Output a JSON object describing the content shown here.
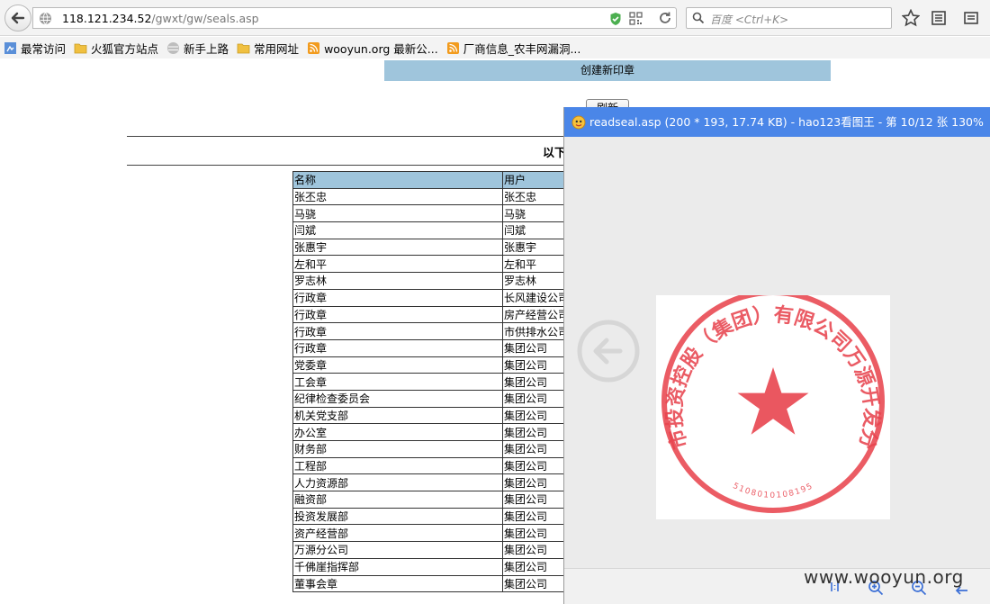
{
  "browser": {
    "url_host": "118.121.234.52",
    "url_path": "/gwxt/gw/seals.asp",
    "search_placeholder": "百度 <Ctrl+K>"
  },
  "bookmarks": [
    {
      "label": "最常访问",
      "icon": "most-visited-icon"
    },
    {
      "label": "火狐官方站点",
      "icon": "folder-icon"
    },
    {
      "label": "新手上路",
      "icon": "globe-icon"
    },
    {
      "label": "常用网址",
      "icon": "folder-icon"
    },
    {
      "label": "wooyun.org 最新公...",
      "icon": "rss-icon"
    },
    {
      "label": "厂商信息_农丰网漏洞...",
      "icon": "rss-icon"
    }
  ],
  "page": {
    "create_seal_link": "创建新印章",
    "refresh_button": "刷新",
    "heading": "以下",
    "table": {
      "headers": [
        "名称",
        "用户"
      ],
      "rows": [
        [
          "张丕忠",
          "张丕忠"
        ],
        [
          "马骁",
          "马骁"
        ],
        [
          "闫斌",
          "闫斌"
        ],
        [
          "张惠宇",
          "张惠宇"
        ],
        [
          "左和平",
          "左和平"
        ],
        [
          "罗志林",
          "罗志林"
        ],
        [
          "行政章",
          "长风建设公司"
        ],
        [
          "行政章",
          "房产经营公司"
        ],
        [
          "行政章",
          "市供排水公司"
        ],
        [
          "行政章",
          "集团公司"
        ],
        [
          "党委章",
          "集团公司"
        ],
        [
          "工会章",
          "集团公司"
        ],
        [
          "纪律检查委员会",
          "集团公司"
        ],
        [
          "机关党支部",
          "集团公司"
        ],
        [
          "办公室",
          "集团公司"
        ],
        [
          "财务部",
          "集团公司"
        ],
        [
          "工程部",
          "集团公司"
        ],
        [
          "人力资源部",
          "集团公司"
        ],
        [
          "融资部",
          "集团公司"
        ],
        [
          "投资发展部",
          "集团公司"
        ],
        [
          "资产经营部",
          "集团公司"
        ],
        [
          "万源分公司",
          "集团公司"
        ],
        [
          "千佛崖指挥部",
          "集团公司"
        ],
        [
          "董事会章",
          "集团公司"
        ]
      ]
    }
  },
  "viewer": {
    "title": "readseal.asp (200 * 193, 17.74 KB) - hao123看图王 - 第 10/12 张 130%",
    "seal": {
      "outer_text": "广元市投资控股（集团）有限公司万源开发分公司",
      "number": "5108010108195",
      "color": "#e8454f"
    }
  },
  "watermark": "www.wooyun.org",
  "colors": {
    "accent_blue": "#9fc5dc",
    "viewer_title": "#4a86e8"
  }
}
